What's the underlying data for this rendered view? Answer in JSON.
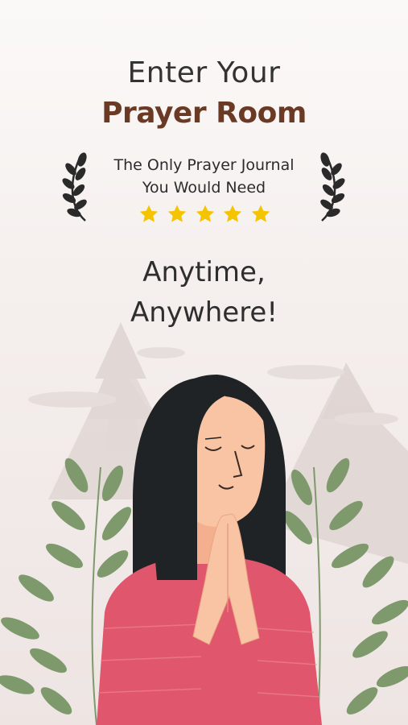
{
  "hero": {
    "headline": "Enter Your",
    "title": "Prayer Room"
  },
  "tagline": {
    "line1": "The Only Prayer Journal",
    "line2": "You Would Need"
  },
  "rating": {
    "stars": 5,
    "star_color": "#f5c400"
  },
  "slogan": {
    "line1": "Anytime,",
    "line2": "Anywhere!"
  },
  "colors": {
    "title_brown": "#6b3a24",
    "background": "#f4eeec",
    "shirt": "#e0566c",
    "hair": "#1f2326",
    "skin": "#f9c4a3",
    "leaves": "#7e9a6c"
  },
  "icons": [
    "laurel-left-icon",
    "laurel-right-icon",
    "star-icon"
  ]
}
